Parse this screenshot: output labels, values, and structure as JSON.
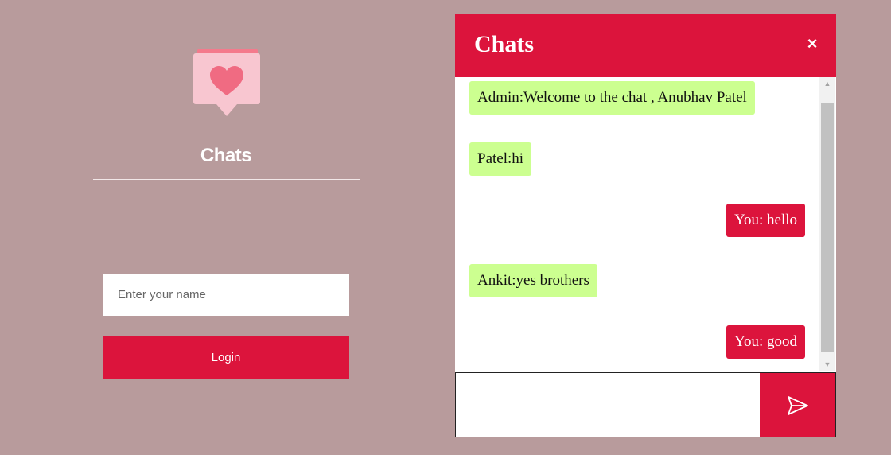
{
  "login": {
    "title": "Chats",
    "name_placeholder": "Enter your name",
    "login_label": "Login",
    "logo_icon": "chat-heart-icon"
  },
  "chat": {
    "title": "Chats",
    "close_label": "×",
    "messages": [
      {
        "direction": "in",
        "text": "Admin:Welcome to the chat , Anubhav Patel"
      },
      {
        "direction": "in",
        "text": "Patel:hi"
      },
      {
        "direction": "out",
        "text": "You: hello"
      },
      {
        "direction": "in",
        "text": "Ankit:yes brothers"
      },
      {
        "direction": "out",
        "text": "You: good"
      }
    ],
    "scroll_up_icon": "▲",
    "scroll_down_icon": "▼",
    "message_input_value": "",
    "send_icon": "send-icon"
  },
  "colors": {
    "background": "#b89b9c",
    "accent": "#dc143c",
    "incoming_bubble": "#ccff90"
  }
}
